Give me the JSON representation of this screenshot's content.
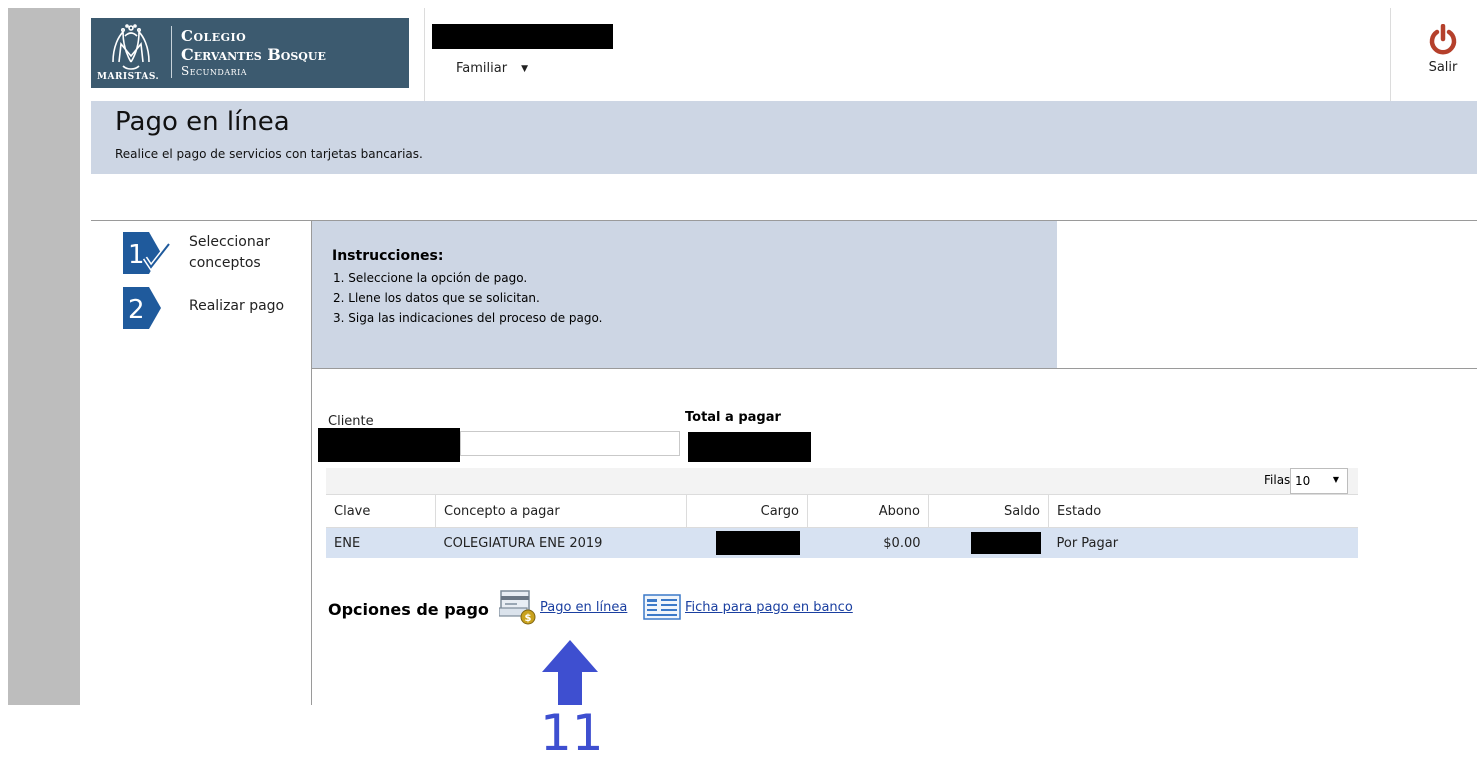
{
  "logo": {
    "line1": "Colegio",
    "line2": "Cervantes Bosque",
    "line3": "Secundaria",
    "maristas": "MARISTAS."
  },
  "header": {
    "user_menu_label": "Familiar",
    "logout_label": "Salir"
  },
  "banner": {
    "title": "Pago en línea",
    "subtitle": "Realice el pago de servicios con tarjetas bancarias."
  },
  "steps": [
    {
      "number": "1",
      "label": "Seleccionar conceptos"
    },
    {
      "number": "2",
      "label": "Realizar pago"
    }
  ],
  "instructions": {
    "title": "Instrucciones:",
    "items": [
      "1. Seleccione la opción de pago.",
      "2. Llene los datos que se solicitan.",
      "3. Siga las indicaciones del proceso de pago."
    ]
  },
  "form": {
    "cliente_label": "Cliente",
    "total_label": "Total a pagar"
  },
  "grid": {
    "rows_label": "Filas",
    "rows_value": "10",
    "columns": [
      "Clave",
      "Concepto a pagar",
      "Cargo",
      "Abono",
      "Saldo",
      "Estado"
    ],
    "rows": [
      {
        "clave": "ENE",
        "concepto": "COLEGIATURA ENE 2019",
        "cargo": "",
        "abono": "$0.00",
        "saldo": "",
        "estado": "Por Pagar"
      }
    ]
  },
  "payment_options": {
    "label": "Opciones de pago",
    "online": "Pago en línea",
    "bank": "Ficha para pago en banco"
  },
  "annotation": {
    "step_number": "11",
    "color": "#3e4fd0"
  },
  "colors": {
    "banner_bg": "#cdd6e4",
    "logo_bg": "#3c5a6f",
    "step_icon": "#1f5a9c",
    "power_icon": "#b5402b",
    "link": "#1a3fa0",
    "row_highlight": "#d7e2f2"
  }
}
